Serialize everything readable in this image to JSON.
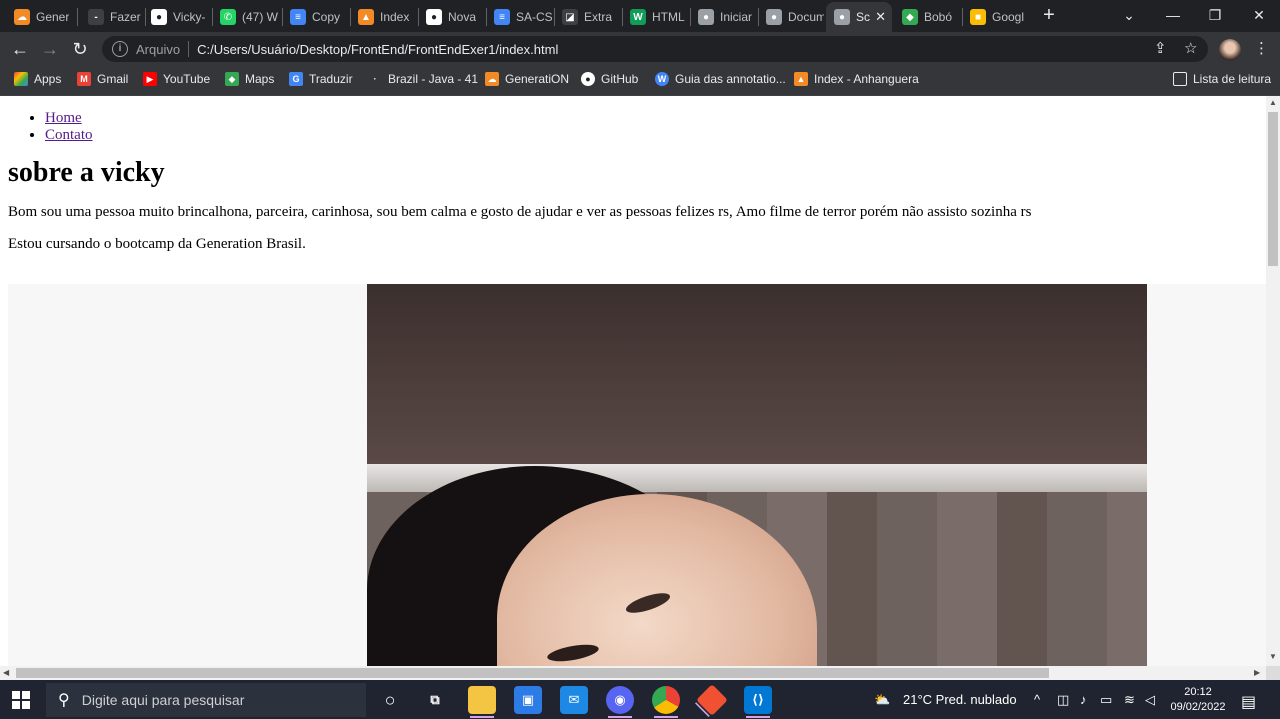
{
  "browser": {
    "tabs": [
      {
        "label": "Gener",
        "icon_color": "#f28b26",
        "glyph": "☁"
      },
      {
        "label": "Fazer",
        "icon_color": "#3c4043",
        "glyph": "-"
      },
      {
        "label": "Vicky-",
        "icon_color": "#ffffff",
        "glyph": "●"
      },
      {
        "label": "(47) W",
        "icon_color": "#25d366",
        "glyph": "✆"
      },
      {
        "label": "Copy",
        "icon_color": "#4285f4",
        "glyph": "≡"
      },
      {
        "label": "Index",
        "icon_color": "#f28b26",
        "glyph": "▲"
      },
      {
        "label": "Nova",
        "icon_color": "#ffffff",
        "glyph": "●"
      },
      {
        "label": "SA-CS",
        "icon_color": "#4285f4",
        "glyph": "≡"
      },
      {
        "label": "Extra",
        "icon_color": "#3c4043",
        "glyph": "◪"
      },
      {
        "label": "HTML",
        "icon_color": "#0f9d58",
        "glyph": "W"
      },
      {
        "label": "Iniciar",
        "icon_color": "#9aa0a6",
        "glyph": "●"
      },
      {
        "label": "Docum",
        "icon_color": "#9aa0a6",
        "glyph": "●"
      },
      {
        "label": "Sc",
        "icon_color": "#9aa0a6",
        "glyph": "●"
      },
      {
        "label": "Bobó",
        "icon_color": "#34a853",
        "glyph": "◆"
      },
      {
        "label": "Googl",
        "icon_color": "#fbbc04",
        "glyph": "■"
      }
    ],
    "active_tab_close": "✕",
    "new_tab": "+",
    "window_controls": {
      "dropdown": "⌄",
      "minimize": "—",
      "restore": "❐",
      "close": "✕"
    },
    "omnibox": {
      "scheme_label": "Arquivo",
      "url": "C:/Users/Usuário/Desktop/FrontEnd/FrontEndExer1/index.html"
    },
    "bookmarks": [
      {
        "label": "Apps",
        "icon_color": "#ea4335",
        "glyph": "⋮"
      },
      {
        "label": "Gmail",
        "icon_color": "#ea4335",
        "glyph": "M"
      },
      {
        "label": "YouTube",
        "icon_color": "#ff0000",
        "glyph": "▶"
      },
      {
        "label": "Maps",
        "icon_color": "#34a853",
        "glyph": "◆"
      },
      {
        "label": "Traduzir",
        "icon_color": "#4285f4",
        "glyph": "G"
      },
      {
        "label": "Brazil - Java - 41",
        "icon_color": "#35363a",
        "glyph": "·"
      },
      {
        "label": "GeneratiON",
        "icon_color": "#f28b26",
        "glyph": "☁"
      },
      {
        "label": "GitHub",
        "icon_color": "#35363a",
        "glyph": "●"
      },
      {
        "label": "Guia das annotatio...",
        "icon_color": "#4285f4",
        "glyph": "W"
      },
      {
        "label": "Index - Anhanguera",
        "icon_color": "#f28b26",
        "glyph": "▲"
      }
    ],
    "reading_list_label": "Lista de leitura"
  },
  "page": {
    "nav": [
      {
        "label": "Home"
      },
      {
        "label": "Contato"
      }
    ],
    "heading": "sobre a vicky",
    "paragraph1": "Bom sou uma pessoa muito brincalhona, parceira, carinhosa, sou bem calma e gosto de ajudar e ver as pessoas felizes rs, Amo filme de terror porém não assisto sozinha rs",
    "paragraph2": "Estou cursando o bootcamp da Generation Brasil."
  },
  "taskbar": {
    "search_placeholder": "Digite aqui para pesquisar",
    "weather": "21°C  Pred. nublado",
    "time": "20:12",
    "date": "09/02/2022"
  },
  "colors": {
    "link": "#551a8b",
    "chrome_dark": "#202124",
    "chrome_toolbar": "#35363a"
  }
}
